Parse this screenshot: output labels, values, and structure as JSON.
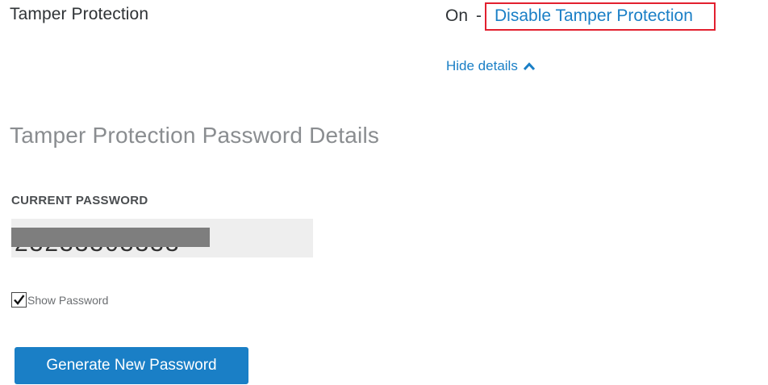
{
  "tamper_protection": {
    "label": "Tamper Protection",
    "status": "On",
    "separator": "-",
    "disable_link": "Disable Tamper Protection",
    "hide_details": "Hide details",
    "hide_details_icon": "chevron-up-icon"
  },
  "password_details": {
    "title": "Tamper Protection Password Details",
    "current_password_label": "CURRENT PASSWORD",
    "current_password_value": "23233303333",
    "show_password_label": "Show Password",
    "show_password_checked": true,
    "generate_button_label": "Generate New Password"
  },
  "colors": {
    "link": "#1a7fc6",
    "highlight_border": "#e2202f",
    "button_bg": "#1a7fc6",
    "field_bg": "#eeeeee",
    "redaction": "#7e7e7e"
  }
}
